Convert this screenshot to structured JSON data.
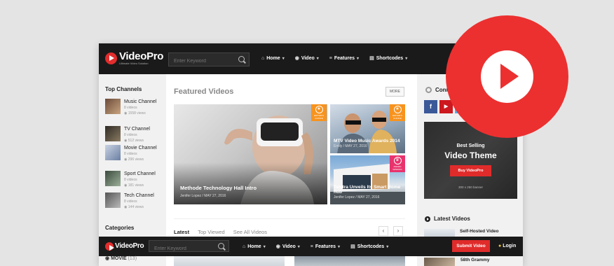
{
  "header": {
    "logo_name": "VideoPro",
    "logo_tagline": "Ultimate Video Solution",
    "search_placeholder": "Enter Keyword",
    "nav": [
      {
        "label": "Home",
        "icon": "home-icon"
      },
      {
        "label": "Video",
        "icon": "video-icon"
      },
      {
        "label": "Features",
        "icon": "list-icon"
      },
      {
        "label": "Shortcodes",
        "icon": "doc-icon"
      }
    ]
  },
  "left_sidebar": {
    "title": "Top Channels",
    "channels": [
      {
        "name": "Music Channel",
        "count": "8 videos",
        "views": "1558 views"
      },
      {
        "name": "TV Channel",
        "count": "8 videos",
        "views": "512 views"
      },
      {
        "name": "Movie Channel",
        "count": "8 videos",
        "views": "296 views"
      },
      {
        "name": "Sport Channel",
        "count": "8 videos",
        "views": "181 views"
      },
      {
        "name": "Tech Channel",
        "count": "8 videos",
        "views": "144 views"
      }
    ],
    "categories_title": "Categories",
    "category": "MOVIE",
    "category_count": "(13)"
  },
  "main": {
    "title": "Featured Videos",
    "more_label": "MORE",
    "hero": {
      "title": "Methode Technology Hall Intro",
      "author": "Jenifer Lopez",
      "date": "MAY 27, 2016",
      "badge": "EDITOR'S CHOICE"
    },
    "side_1": {
      "title": "MTV Video Music Awards 2014",
      "author": "Emily",
      "date": "MAY 27, 2016",
      "badge": "EDITOR'S CHOICE"
    },
    "side_2": {
      "title": "Telstra Unveils Its Smart Home hub",
      "author": "Jenifer Lopez",
      "date": "MAY 27, 2016",
      "badge": "AWARD WINNING"
    },
    "tabs": [
      "Latest",
      "Top Viewed",
      "See All Videos"
    ],
    "pager_prev": "‹",
    "pager_next": "›"
  },
  "right_sidebar": {
    "connect_title": "Connect",
    "social": [
      "f",
      "▶",
      "t"
    ],
    "ad": {
      "sub": "Best Selling",
      "main": "Video Theme",
      "button": "Buy VideoPro",
      "note": "300 x 250 banner"
    },
    "latest_title": "Latest Videos",
    "latest_items": [
      "Self-Hosted Video",
      "58th Grammy"
    ]
  },
  "sticky": {
    "logo_name": "VideoPro",
    "search_placeholder": "Enter Keyword",
    "nav": [
      "Home",
      "Video",
      "Features",
      "Shortcodes"
    ],
    "submit": "Submit Video",
    "login": "Login"
  },
  "colors": {
    "accent": "#e02b2b",
    "dark": "#1a1a1a",
    "badge_orange": "#f7931e",
    "badge_pink": "#e8336d"
  }
}
